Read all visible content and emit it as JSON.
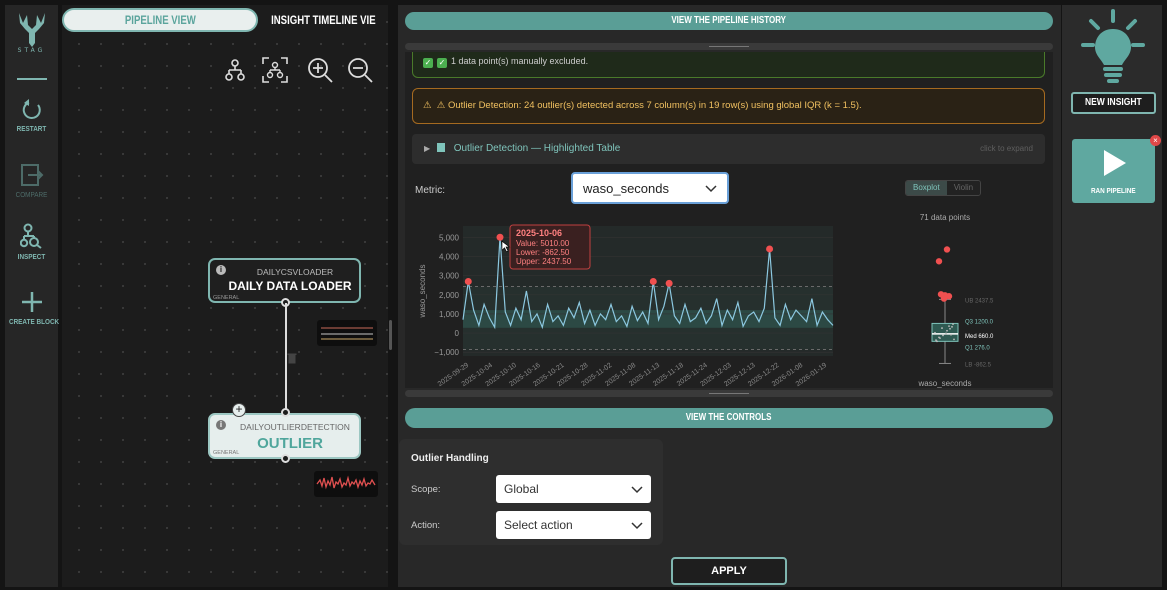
{
  "app": {
    "logo_text": "STAG"
  },
  "left_toolbar": {
    "items": [
      {
        "label": "RESTART",
        "icon": "restart-icon"
      },
      {
        "label": "COMPARE",
        "icon": "compare-icon",
        "disabled": true
      },
      {
        "label": "INSPECT",
        "icon": "inspect-icon"
      },
      {
        "label": "CREATE BLOCK",
        "icon": "plus-icon"
      }
    ]
  },
  "tabs": {
    "pipeline_view": "PIPELINE VIEW",
    "insight_timeline": "INSIGHT TIMELINE VIE"
  },
  "canvas_tools": [
    "hierarchy-icon",
    "fit-view-icon",
    "zoom-in-icon",
    "zoom-out-icon"
  ],
  "nodes": [
    {
      "type": "DAILYCSVLOADER",
      "title": "DAILY DATA LOADER",
      "tag": "GENERAL"
    },
    {
      "type": "DAILYOUTLIERDETECTION",
      "title": "OUTLIER",
      "tag": "GENERAL"
    }
  ],
  "main": {
    "history_button": "VIEW THE PIPELINE HISTORY",
    "banner_excluded": "1 data point(s) manually excluded.",
    "banner_warning": "Outlier Detection: 24 outlier(s) detected across 7 column(s) in 19 row(s) using global IQR (k = 1.5).",
    "expander_title": "Outlier Detection — Highlighted Table",
    "expander_hint": "click to expand",
    "metric_label": "Metric:",
    "metric_value": "waso_seconds",
    "view_toggle": {
      "options": [
        "Boxplot",
        "Violin"
      ],
      "selected": "Boxplot"
    },
    "controls_button": "VIEW THE CONTROLS",
    "controls": {
      "title": "Outlier Handling",
      "scope_label": "Scope:",
      "scope_value": "Global",
      "action_label": "Action:",
      "action_placeholder": "Select action"
    },
    "apply_button": "APPLY"
  },
  "right_panel": {
    "new_insight": "NEW INSIGHT",
    "run_pipeline": "RAN PIPELINE"
  },
  "colors": {
    "accent": "#5fa8a0",
    "warning": "#f0c060",
    "outlier": "#f05050",
    "line": "#8cc8e0"
  },
  "chart_data": [
    {
      "type": "line",
      "ylabel": "waso_seconds",
      "ylim": [
        -1200,
        5600
      ],
      "yticks": [
        "5,000",
        "4,000",
        "3,000",
        "2,000",
        "1,000",
        "0",
        "−1,000"
      ],
      "xticks": [
        "2025-09-29",
        "2025-10-04",
        "2025-10-10",
        "2025-10-16",
        "2025-10-21",
        "2025-10-28",
        "2025-11-02",
        "2025-11-08",
        "2025-11-13",
        "2025-11-18",
        "2025-11-24",
        "2025-12-03",
        "2025-12-13",
        "2025-12-22",
        "2026-01-08",
        "2026-01-19"
      ],
      "bands": {
        "upper": 2437.5,
        "q3": 1200,
        "q1": 276,
        "lower": -862.5
      },
      "series": [
        {
          "values": [
            700,
            2700,
            1200,
            400,
            1500,
            800,
            300,
            5010,
            1100,
            400,
            1300,
            700,
            2200,
            600,
            1000,
            300,
            1500,
            600,
            900,
            400,
            1300,
            800,
            1600,
            500,
            1200,
            400,
            1000,
            700,
            1500,
            600,
            900,
            350,
            1400,
            650,
            1100,
            500,
            2700,
            700,
            1400,
            2600,
            900,
            500,
            1500,
            600,
            800,
            1300,
            500,
            900,
            1800,
            400,
            1200,
            700,
            1600,
            350,
            900,
            1100,
            600,
            1300,
            4400,
            800,
            400,
            1500,
            700,
            1200,
            900,
            600,
            1800,
            400,
            1100,
            700,
            400
          ],
          "outliers": [
            [
              1,
              2700
            ],
            [
              7,
              5010
            ],
            [
              36,
              2700
            ],
            [
              39,
              2600
            ],
            [
              58,
              4400
            ]
          ]
        }
      ],
      "tooltip": {
        "date": "2025-10-06",
        "value": "5010.00",
        "lower": "-862.50",
        "upper": "2437.50"
      }
    },
    {
      "type": "boxplot",
      "title": "71 data points",
      "xlabel": "waso_seconds",
      "q1": 276,
      "median": 660,
      "q3": 1200,
      "upper_fence": 2437.5,
      "lower_fence": -862.5,
      "labels": [
        "UB 2437.5",
        "Q3 1200.0",
        "Med 660.0",
        "Q1 276.0",
        "LB -862.5"
      ],
      "outliers": [
        5010,
        4400,
        2700,
        2650,
        2600,
        2480
      ]
    }
  ]
}
